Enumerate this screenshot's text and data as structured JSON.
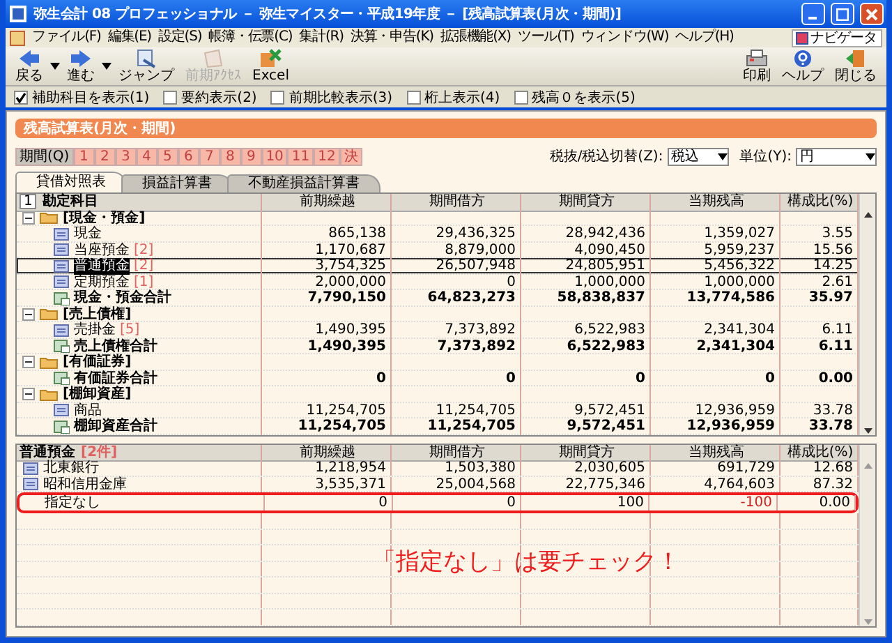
{
  "window": {
    "title": "弥生会計 08 プロフェッショナル － 弥生マイスター・平成19年度 － [残高試算表(月次・期間)]"
  },
  "menu": [
    "ファイル(F)",
    "編集(E)",
    "設定(S)",
    "帳簿・伝票(C)",
    "集計(R)",
    "決算・申告(K)",
    "拡張機能(X)",
    "ツール(T)",
    "ウィンドウ(W)",
    "ヘルプ(H)"
  ],
  "navigator": "ナビゲータ",
  "toolbar_left": [
    {
      "kind": "back",
      "label": "戻る",
      "dropdown": true,
      "disabled": false
    },
    {
      "kind": "forward",
      "label": "進む",
      "dropdown": true,
      "disabled": false
    },
    {
      "kind": "jump",
      "label": "ジャンプ",
      "dropdown": false,
      "disabled": false
    },
    {
      "kind": "prior",
      "label": "前期ｱｸｾｽ",
      "dropdown": false,
      "disabled": true
    },
    {
      "kind": "excel",
      "label": "Excel",
      "dropdown": false,
      "disabled": false
    }
  ],
  "toolbar_right": [
    {
      "kind": "print",
      "label": "印刷"
    },
    {
      "kind": "help",
      "label": "ヘルプ"
    },
    {
      "kind": "close",
      "label": "閉じる"
    }
  ],
  "options": [
    {
      "label": "補助科目を表示(1)",
      "checked": true
    },
    {
      "label": "要約表示(2)",
      "checked": false
    },
    {
      "label": "前期比較表示(3)",
      "checked": false
    },
    {
      "label": "桁上表示(4)",
      "checked": false
    },
    {
      "label": "残高０を表示(5)",
      "checked": false
    }
  ],
  "report_title": "残高試算表(月次・期間)",
  "periods": [
    {
      "label": "期間(Q)",
      "selected": true
    },
    {
      "label": "1",
      "selected": false
    },
    {
      "label": "2",
      "selected": false
    },
    {
      "label": "3",
      "selected": false
    },
    {
      "label": "4",
      "selected": false
    },
    {
      "label": "5",
      "selected": false
    },
    {
      "label": "6",
      "selected": false
    },
    {
      "label": "7",
      "selected": false
    },
    {
      "label": "8",
      "selected": false
    },
    {
      "label": "9",
      "selected": false
    },
    {
      "label": "10",
      "selected": false
    },
    {
      "label": "11",
      "selected": false
    },
    {
      "label": "12",
      "selected": false
    },
    {
      "label": "決",
      "selected": false
    }
  ],
  "tax_switch": {
    "label": "税抜/税込切替(Z):",
    "value": "税込"
  },
  "unit": {
    "label": "単位(Y):",
    "value": "円"
  },
  "tabs": [
    {
      "label": "貸借対照表",
      "selected": true
    },
    {
      "label": "損益計算書",
      "selected": false
    },
    {
      "label": "不動産損益計算書",
      "selected": false
    }
  ],
  "table": {
    "row_header": "1",
    "columns": [
      "勘定科目",
      "前期繰越",
      "期間借方",
      "期間貸方",
      "当期残高",
      "構成比(%)"
    ],
    "rows": [
      {
        "kind": "group",
        "name": "[現金・預金]",
        "expanded": true,
        "children": [
          {
            "kind": "account",
            "name": "現金",
            "selected": false,
            "values": [
              "865,138",
              "29,436,325",
              "28,942,436",
              "1,359,027",
              "3.55"
            ]
          },
          {
            "kind": "account",
            "name": "当座預金",
            "count": "[2]",
            "selected": false,
            "values": [
              "1,170,687",
              "8,879,000",
              "4,090,450",
              "5,959,237",
              "15.56"
            ]
          },
          {
            "kind": "account",
            "name": "普通預金",
            "count": "[2]",
            "selected": true,
            "values": [
              "3,754,325",
              "26,507,948",
              "24,805,951",
              "5,456,322",
              "14.25"
            ]
          },
          {
            "kind": "account",
            "name": "定期預金",
            "count": "[1]",
            "selected": false,
            "values": [
              "2,000,000",
              "0",
              "1,000,000",
              "1,000,000",
              "2.61"
            ]
          },
          {
            "kind": "total",
            "name": "現金・預金合計",
            "selected": false,
            "values": [
              "7,790,150",
              "64,823,273",
              "58,838,837",
              "13,774,586",
              "35.97"
            ]
          }
        ]
      },
      {
        "kind": "group",
        "name": "[売上債権]",
        "expanded": true,
        "children": [
          {
            "kind": "account",
            "name": "売掛金",
            "count": "[5]",
            "selected": false,
            "values": [
              "1,490,395",
              "7,373,892",
              "6,522,983",
              "2,341,304",
              "6.11"
            ]
          },
          {
            "kind": "total",
            "name": "売上債権合計",
            "selected": false,
            "values": [
              "1,490,395",
              "7,373,892",
              "6,522,983",
              "2,341,304",
              "6.11"
            ]
          }
        ]
      },
      {
        "kind": "group",
        "name": "[有価証券]",
        "expanded": true,
        "children": [
          {
            "kind": "total",
            "name": "有価証券合計",
            "selected": false,
            "values": [
              "0",
              "0",
              "0",
              "0",
              "0.00"
            ]
          }
        ]
      },
      {
        "kind": "group",
        "name": "[棚卸資産]",
        "expanded": true,
        "children": [
          {
            "kind": "account",
            "name": "商品",
            "selected": false,
            "values": [
              "11,254,705",
              "11,254,705",
              "9,572,451",
              "12,936,959",
              "33.78"
            ]
          },
          {
            "kind": "total",
            "name": "棚卸資産合計",
            "selected": false,
            "values": [
              "11,254,705",
              "11,254,705",
              "9,572,451",
              "12,936,959",
              "33.78"
            ]
          }
        ]
      }
    ]
  },
  "detail": {
    "title": "普通預金",
    "count": "[2件]",
    "columns": [
      "前期繰越",
      "期間借方",
      "期間貸方",
      "当期残高",
      "構成比(%)"
    ],
    "rows": [
      {
        "name": "北東銀行",
        "icon": true,
        "negative": false,
        "highlighted": false,
        "values": [
          "1,218,954",
          "1,503,380",
          "2,030,605",
          "691,729",
          "12.68"
        ]
      },
      {
        "name": "昭和信用金庫",
        "icon": true,
        "negative": false,
        "highlighted": false,
        "values": [
          "3,535,371",
          "25,004,568",
          "22,775,346",
          "4,764,603",
          "87.32"
        ]
      },
      {
        "name": "指定なし",
        "icon": false,
        "negative": true,
        "highlighted": true,
        "values": [
          "0",
          "0",
          "100",
          "-100",
          "0.00"
        ]
      }
    ]
  },
  "annotation": "「指定なし」は要チェック！"
}
